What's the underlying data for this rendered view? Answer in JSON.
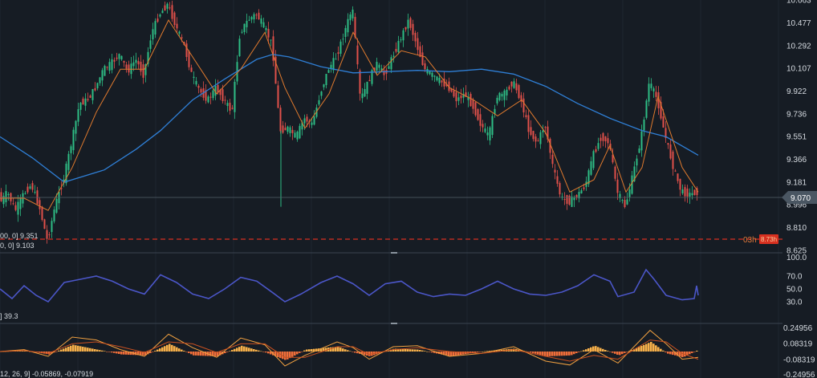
{
  "colors": {
    "background": "#161c24",
    "grid": "#26303b",
    "up": "#2ebd85",
    "down": "#e0504a",
    "ma_fast": "#e07a2e",
    "ma_slow": "#2f7fd6",
    "rsi": "#4b56c8",
    "macd_line": "#f0a040",
    "signal_line": "#c85020",
    "hist_pos": "#f6b04a",
    "hist_neg": "#f06e3a",
    "last_price_box": "#4a5662",
    "alert": "#d83020"
  },
  "price_axis": {
    "ticks": [
      "10.663",
      "10.477",
      "10.292",
      "10.107",
      "9.922",
      "9.736",
      "9.551",
      "9.366",
      "9.181",
      "8.996",
      "8.810",
      "8.625"
    ],
    "last_price": "9.070",
    "alert_label": "03h",
    "alert_box": "8.73h"
  },
  "legends": {
    "ma_fast": "00, 0] 9.351",
    "ma_slow": "0, 0] 9.103",
    "rsi": "] 39.3",
    "macd": "12, 26, 9] -0.05869, -0.07919"
  },
  "rsi_axis": {
    "ticks": [
      "100.0",
      "70.0",
      "50.0",
      "30.0"
    ]
  },
  "macd_axis": {
    "ticks": [
      "0.24956",
      "0.08319",
      "-0.08319",
      "-0.24956"
    ]
  },
  "chart_data": {
    "type": "line",
    "ylim": [
      8.625,
      10.663
    ],
    "price_path": [
      [
        0,
        9.0
      ],
      [
        10,
        9.1
      ],
      [
        20,
        8.95
      ],
      [
        30,
        9.08
      ],
      [
        40,
        9.16
      ],
      [
        50,
        8.98
      ],
      [
        60,
        8.7
      ],
      [
        70,
        9.0
      ],
      [
        80,
        9.2
      ],
      [
        90,
        9.5
      ],
      [
        100,
        9.82
      ],
      [
        110,
        9.85
      ],
      [
        120,
        9.95
      ],
      [
        130,
        10.1
      ],
      [
        140,
        10.15
      ],
      [
        150,
        10.22
      ],
      [
        160,
        10.08
      ],
      [
        170,
        10.18
      ],
      [
        180,
        10.05
      ],
      [
        190,
        10.4
      ],
      [
        200,
        10.55
      ],
      [
        210,
        10.63
      ],
      [
        220,
        10.45
      ],
      [
        230,
        10.3
      ],
      [
        240,
        10.05
      ],
      [
        250,
        9.92
      ],
      [
        260,
        9.85
      ],
      [
        270,
        9.95
      ],
      [
        280,
        9.85
      ],
      [
        290,
        9.75
      ],
      [
        300,
        10.4
      ],
      [
        310,
        10.5
      ],
      [
        320,
        10.55
      ],
      [
        330,
        10.45
      ],
      [
        340,
        10.3
      ],
      [
        350,
        9.6
      ],
      [
        360,
        9.62
      ],
      [
        370,
        9.55
      ],
      [
        380,
        9.7
      ],
      [
        390,
        9.65
      ],
      [
        400,
        9.9
      ],
      [
        410,
        10.1
      ],
      [
        420,
        10.2
      ],
      [
        430,
        10.4
      ],
      [
        440,
        10.6
      ],
      [
        450,
        9.85
      ],
      [
        460,
        10.0
      ],
      [
        470,
        10.15
      ],
      [
        480,
        10.05
      ],
      [
        490,
        10.2
      ],
      [
        500,
        10.35
      ],
      [
        510,
        10.5
      ],
      [
        520,
        10.3
      ],
      [
        530,
        10.1
      ],
      [
        540,
        10.05
      ],
      [
        550,
        10.0
      ],
      [
        560,
        9.95
      ],
      [
        570,
        9.85
      ],
      [
        580,
        9.9
      ],
      [
        590,
        9.8
      ],
      [
        600,
        9.65
      ],
      [
        610,
        9.55
      ],
      [
        620,
        9.88
      ],
      [
        630,
        9.9
      ],
      [
        640,
        10.0
      ],
      [
        650,
        9.85
      ],
      [
        660,
        9.6
      ],
      [
        670,
        9.5
      ],
      [
        680,
        9.65
      ],
      [
        690,
        9.3
      ],
      [
        700,
        9.05
      ],
      [
        710,
        9.02
      ],
      [
        720,
        9.07
      ],
      [
        730,
        9.15
      ],
      [
        740,
        9.4
      ],
      [
        750,
        9.55
      ],
      [
        760,
        9.5
      ],
      [
        770,
        9.1
      ],
      [
        780,
        8.98
      ],
      [
        790,
        9.25
      ],
      [
        800,
        9.55
      ],
      [
        810,
        10.0
      ],
      [
        820,
        9.85
      ],
      [
        830,
        9.55
      ],
      [
        840,
        9.3
      ],
      [
        850,
        9.1
      ],
      [
        860,
        9.08
      ],
      [
        870,
        9.1
      ]
    ],
    "ma_fast_path": [
      [
        0,
        9.05
      ],
      [
        30,
        9.05
      ],
      [
        60,
        8.95
      ],
      [
        90,
        9.3
      ],
      [
        120,
        9.75
      ],
      [
        150,
        10.1
      ],
      [
        180,
        10.1
      ],
      [
        210,
        10.5
      ],
      [
        240,
        10.2
      ],
      [
        270,
        9.9
      ],
      [
        300,
        10.1
      ],
      [
        330,
        10.4
      ],
      [
        355,
        9.95
      ],
      [
        380,
        9.62
      ],
      [
        410,
        9.9
      ],
      [
        440,
        10.4
      ],
      [
        470,
        10.05
      ],
      [
        500,
        10.25
      ],
      [
        530,
        10.2
      ],
      [
        560,
        9.95
      ],
      [
        590,
        9.85
      ],
      [
        620,
        9.72
      ],
      [
        650,
        9.85
      ],
      [
        680,
        9.58
      ],
      [
        710,
        9.1
      ],
      [
        740,
        9.2
      ],
      [
        760,
        9.48
      ],
      [
        780,
        9.1
      ],
      [
        800,
        9.3
      ],
      [
        820,
        9.88
      ],
      [
        850,
        9.3
      ],
      [
        870,
        9.1
      ]
    ],
    "ma_slow_path": [
      [
        0,
        9.55
      ],
      [
        40,
        9.38
      ],
      [
        80,
        9.18
      ],
      [
        130,
        9.28
      ],
      [
        170,
        9.45
      ],
      [
        200,
        9.6
      ],
      [
        240,
        9.85
      ],
      [
        280,
        10.02
      ],
      [
        320,
        10.18
      ],
      [
        340,
        10.22
      ],
      [
        360,
        10.2
      ],
      [
        400,
        10.12
      ],
      [
        440,
        10.07
      ],
      [
        480,
        10.08
      ],
      [
        520,
        10.09
      ],
      [
        560,
        10.08
      ],
      [
        600,
        10.1
      ],
      [
        640,
        10.06
      ],
      [
        680,
        9.96
      ],
      [
        720,
        9.82
      ],
      [
        760,
        9.7
      ],
      [
        800,
        9.6
      ],
      [
        830,
        9.55
      ],
      [
        870,
        9.4
      ]
    ],
    "rsi_ylim": [
      0,
      100
    ],
    "rsi_path": [
      [
        0,
        50
      ],
      [
        15,
        35
      ],
      [
        30,
        55
      ],
      [
        45,
        40
      ],
      [
        60,
        30
      ],
      [
        80,
        60
      ],
      [
        100,
        65
      ],
      [
        120,
        70
      ],
      [
        140,
        62
      ],
      [
        160,
        50
      ],
      [
        180,
        42
      ],
      [
        200,
        72
      ],
      [
        220,
        60
      ],
      [
        240,
        42
      ],
      [
        260,
        35
      ],
      [
        280,
        50
      ],
      [
        300,
        68
      ],
      [
        320,
        62
      ],
      [
        340,
        44
      ],
      [
        355,
        30
      ],
      [
        375,
        42
      ],
      [
        400,
        60
      ],
      [
        420,
        70
      ],
      [
        440,
        58
      ],
      [
        460,
        40
      ],
      [
        480,
        58
      ],
      [
        500,
        62
      ],
      [
        520,
        45
      ],
      [
        540,
        38
      ],
      [
        560,
        42
      ],
      [
        580,
        40
      ],
      [
        600,
        50
      ],
      [
        620,
        62
      ],
      [
        640,
        50
      ],
      [
        660,
        42
      ],
      [
        680,
        40
      ],
      [
        700,
        45
      ],
      [
        720,
        55
      ],
      [
        740,
        72
      ],
      [
        760,
        62
      ],
      [
        770,
        38
      ],
      [
        790,
        45
      ],
      [
        805,
        80
      ],
      [
        815,
        65
      ],
      [
        830,
        40
      ],
      [
        850,
        33
      ],
      [
        865,
        35
      ],
      [
        868,
        55
      ],
      [
        870,
        40
      ]
    ],
    "macd_ylim": [
      -0.24956,
      0.24956
    ],
    "macd_line_path": [
      [
        0,
        0.0
      ],
      [
        30,
        0.02
      ],
      [
        60,
        -0.05
      ],
      [
        90,
        0.15
      ],
      [
        120,
        0.12
      ],
      [
        150,
        0.02
      ],
      [
        180,
        -0.05
      ],
      [
        210,
        0.18
      ],
      [
        240,
        0.04
      ],
      [
        270,
        -0.06
      ],
      [
        300,
        0.14
      ],
      [
        330,
        0.07
      ],
      [
        355,
        -0.15
      ],
      [
        380,
        -0.04
      ],
      [
        420,
        0.1
      ],
      [
        440,
        0.04
      ],
      [
        460,
        -0.08
      ],
      [
        490,
        0.05
      ],
      [
        520,
        0.06
      ],
      [
        560,
        -0.05
      ],
      [
        600,
        -0.02
      ],
      [
        640,
        0.05
      ],
      [
        680,
        -0.1
      ],
      [
        710,
        -0.14
      ],
      [
        740,
        0.02
      ],
      [
        770,
        -0.12
      ],
      [
        810,
        0.22
      ],
      [
        830,
        0.08
      ],
      [
        850,
        -0.08
      ],
      [
        870,
        -0.06
      ]
    ],
    "signal_path": [
      [
        0,
        0.0
      ],
      [
        30,
        0.01
      ],
      [
        60,
        -0.02
      ],
      [
        90,
        0.08
      ],
      [
        120,
        0.1
      ],
      [
        150,
        0.05
      ],
      [
        180,
        -0.01
      ],
      [
        210,
        0.1
      ],
      [
        240,
        0.08
      ],
      [
        270,
        -0.01
      ],
      [
        300,
        0.08
      ],
      [
        330,
        0.08
      ],
      [
        355,
        -0.06
      ],
      [
        380,
        -0.06
      ],
      [
        420,
        0.05
      ],
      [
        440,
        0.05
      ],
      [
        460,
        -0.03
      ],
      [
        490,
        0.02
      ],
      [
        520,
        0.04
      ],
      [
        560,
        0.0
      ],
      [
        600,
        -0.02
      ],
      [
        640,
        0.02
      ],
      [
        680,
        -0.05
      ],
      [
        710,
        -0.1
      ],
      [
        740,
        -0.04
      ],
      [
        770,
        -0.08
      ],
      [
        810,
        0.12
      ],
      [
        830,
        0.1
      ],
      [
        850,
        -0.02
      ],
      [
        870,
        -0.08
      ]
    ]
  }
}
